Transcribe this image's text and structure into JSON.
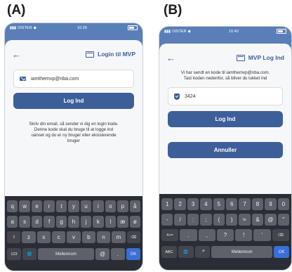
{
  "panels": {
    "a": {
      "label": "(A)"
    },
    "b": {
      "label": "(B)"
    }
  },
  "phone_a": {
    "status": {
      "carrier": "OISTER",
      "time": "10.39"
    },
    "title": "Login til MVP",
    "email_value": "iamthemvp@nba.com",
    "login_button": "Log Ind",
    "info_text": "Skriv din email, så sender vi dig en login kode.\nDenne kode skal du bruge til at logge ind\nuanset og du er ny bruger eller eksisterende\nbruger",
    "keyboard": {
      "row1": [
        "q",
        "w",
        "e",
        "r",
        "t",
        "y",
        "u",
        "i",
        "o",
        "p",
        "å"
      ],
      "row2": [
        "a",
        "s",
        "d",
        "f",
        "g",
        "h",
        "j",
        "k",
        "l",
        "æ",
        "ø"
      ],
      "row3": [
        "⇧",
        "z",
        "x",
        "c",
        "v",
        "b",
        "n",
        "m",
        "⌫"
      ],
      "row4": [
        "123",
        "🌐",
        "Mellemrum",
        "@",
        ".",
        "OK"
      ]
    }
  },
  "phone_b": {
    "status": {
      "carrier": "OISTER",
      "time": "10.40"
    },
    "title": "MVP Log Ind",
    "info_text": "Vi har sendt en kode til iamthemvp@nba.com.\nTast koden nedenfor, så bliver du lukket ind",
    "code_value": "3424",
    "login_button": "Log Ind",
    "cancel_button": "Annuller",
    "keyboard": {
      "row1": [
        "1",
        "2",
        "3",
        "4",
        "5",
        "6",
        "7",
        "8",
        "9",
        "0"
      ],
      "row2": [
        "-",
        "/",
        ":",
        ";",
        "(",
        ")",
        "kr",
        "&",
        "@",
        "\""
      ],
      "row3": [
        "#+=",
        ".",
        ",",
        "?",
        "!",
        "'",
        "⌫"
      ],
      "row4": [
        "ABC",
        "🌐",
        "🎤",
        "Mellemrum",
        "OK"
      ]
    }
  }
}
